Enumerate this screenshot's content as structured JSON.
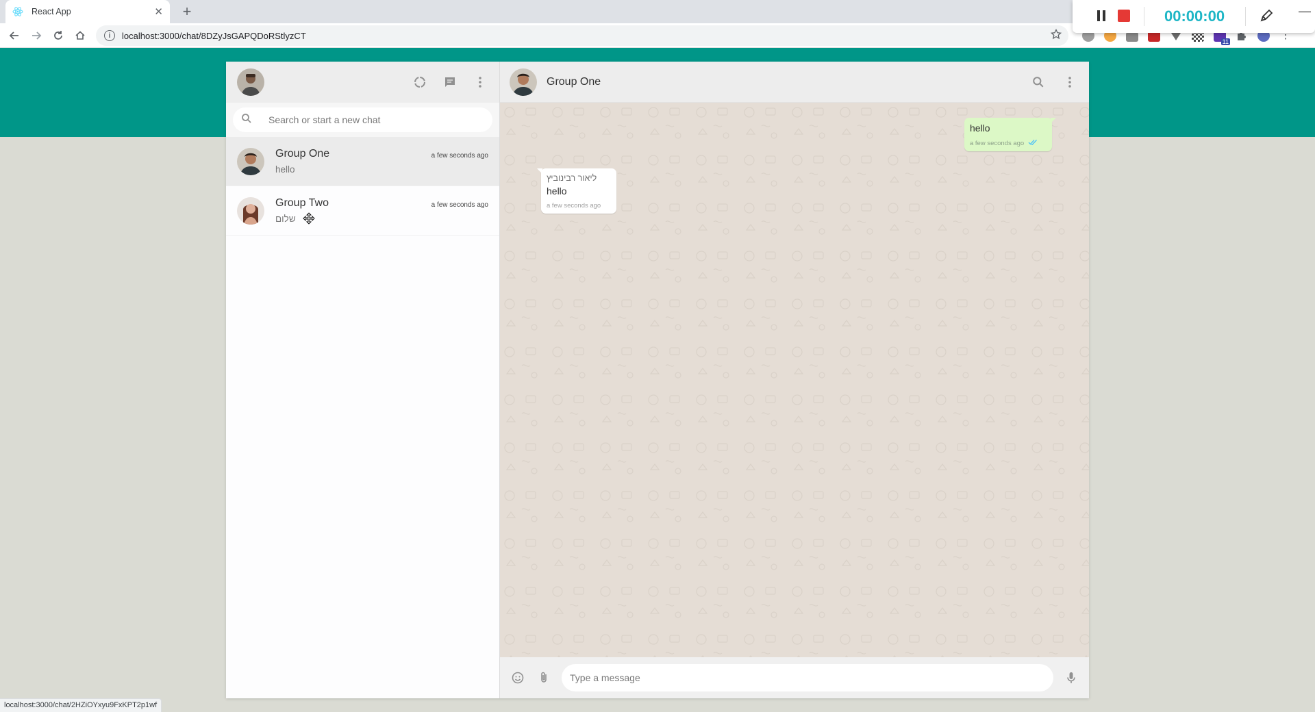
{
  "browser": {
    "tab_title": "React App",
    "url": "localhost:3000/chat/8DZyJsGAPQDoRStlyzCT",
    "status_url": "localhost:3000/chat/2HZiOYxyu9FxKPT2p1wf",
    "extension_badge": "11"
  },
  "recorder": {
    "timer": "00:00:00"
  },
  "sidebar": {
    "search_placeholder": "Search or start a new chat",
    "chats": [
      {
        "name": "Group One",
        "last_message": "hello",
        "time": "a few seconds ago",
        "active": true
      },
      {
        "name": "Group Two",
        "last_message": "שלום",
        "time": "a few seconds ago",
        "active": false
      }
    ]
  },
  "chat": {
    "title": "Group One",
    "messages": [
      {
        "direction": "outgoing",
        "text": "hello",
        "time": "a few seconds ago"
      },
      {
        "direction": "incoming",
        "sender": "ליאור רבינוביץ",
        "text": "hello",
        "time": "a few seconds ago"
      }
    ],
    "input_placeholder": "Type a message"
  },
  "colors": {
    "brand_teal": "#009688",
    "outgoing_bubble": "#dcf8c6",
    "chat_background": "#e5ddd5",
    "recorder_timer": "#1eb6c6",
    "recorder_stop": "#e53935"
  }
}
